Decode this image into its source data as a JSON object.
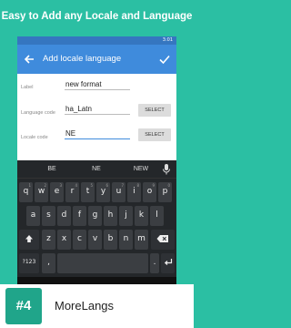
{
  "banner": {
    "text": "Easy to Add any Locale and Language"
  },
  "status": {
    "time": "3:01"
  },
  "appbar": {
    "title": "Add locale language",
    "back_icon": "arrow-left-icon",
    "confirm_icon": "check-icon"
  },
  "form": {
    "label_caption": "Label",
    "label_value": "new format",
    "language_caption": "Language code",
    "language_value": "ha_Latn",
    "language_select": "SELECT",
    "locale_caption": "Locale code",
    "locale_value": "NE",
    "locale_select": "SELECT"
  },
  "keyboard": {
    "suggestions": [
      "BE",
      "NE",
      "NEW"
    ],
    "row1": [
      "q",
      "w",
      "e",
      "r",
      "t",
      "y",
      "u",
      "i",
      "o",
      "p"
    ],
    "row1_alt": [
      "1",
      "2",
      "3",
      "4",
      "5",
      "6",
      "7",
      "8",
      "9",
      "0"
    ],
    "row2": [
      "a",
      "s",
      "d",
      "f",
      "g",
      "h",
      "j",
      "k",
      "l"
    ],
    "row3": [
      "z",
      "x",
      "c",
      "v",
      "b",
      "n",
      "m"
    ],
    "symbols_key": "?123",
    "comma": ",",
    "period": "."
  },
  "footer": {
    "rank": "#4",
    "app_name": "MoreLangs"
  },
  "colors": {
    "background": "#2bbfa3",
    "appbar": "#3f8bdc",
    "statusbar": "#3576c0",
    "keyboard": "#24272a",
    "badge": "#20a58a"
  }
}
